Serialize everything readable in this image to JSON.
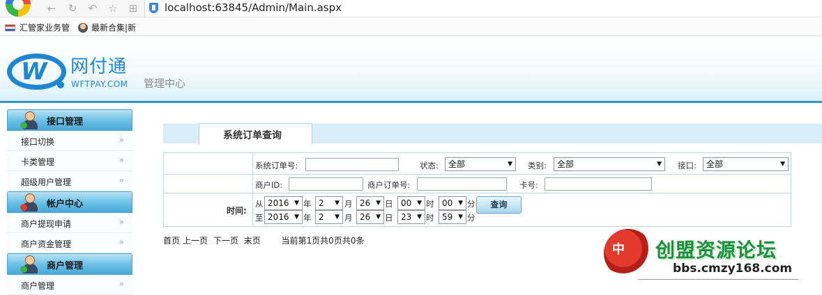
{
  "browser": {
    "url": "localhost:63845/Admin/Main.aspx",
    "nav_icons": [
      "back-icon",
      "refresh-icon",
      "undo-icon",
      "star-icon",
      "grid-icon"
    ],
    "bookmarks": [
      {
        "label": "汇管家业务管",
        "icon": "flag-icon"
      },
      {
        "label": "最新合集|新",
        "icon": "person-icon"
      }
    ]
  },
  "header": {
    "logo_cn": "网付通",
    "logo_en": "WFTPAY.COM",
    "subtitle": "管理中心"
  },
  "sidebar": {
    "sections": [
      {
        "title": "接口管理",
        "items": [
          "接口切换",
          "卡类管理",
          "超级用户管理"
        ]
      },
      {
        "title": "帐户中心",
        "items": [
          "商户提现申请",
          "商户资金管理"
        ]
      },
      {
        "title": "商户管理",
        "items": [
          "商户管理"
        ]
      }
    ],
    "arrow": "»"
  },
  "main": {
    "tab_label": "系统订单查询",
    "form": {
      "order_no_label": "系统订单号:",
      "status_label": "状态:",
      "status_value": "全部",
      "type_label": "类别:",
      "type_value": "全部",
      "interface_label": "接口:",
      "interface_value": "全部",
      "merchant_id_label": "商户ID:",
      "merchant_order_label": "商户订单号:",
      "card_no_label": "卡号:",
      "time_label": "时间:",
      "from_label": "从",
      "to_label": "至",
      "year_unit": "年",
      "month_unit": "月",
      "day_unit": "日",
      "hour_unit": "时",
      "minute_unit": "分",
      "from": {
        "year": "2016",
        "month": "2",
        "day": "26",
        "hour": "00",
        "minute": "00"
      },
      "to": {
        "year": "2016",
        "month": "2",
        "day": "26",
        "hour": "23",
        "minute": "59"
      },
      "query_button": "查询"
    },
    "pager": {
      "first": "首页",
      "prev": "上一页",
      "next": "下一页",
      "last": "末页",
      "info": "当前第1页共0页共0条"
    }
  },
  "watermark": {
    "logo_text": "中",
    "title": "创盟资源论坛",
    "url": "bbs.cmzy168.com"
  }
}
